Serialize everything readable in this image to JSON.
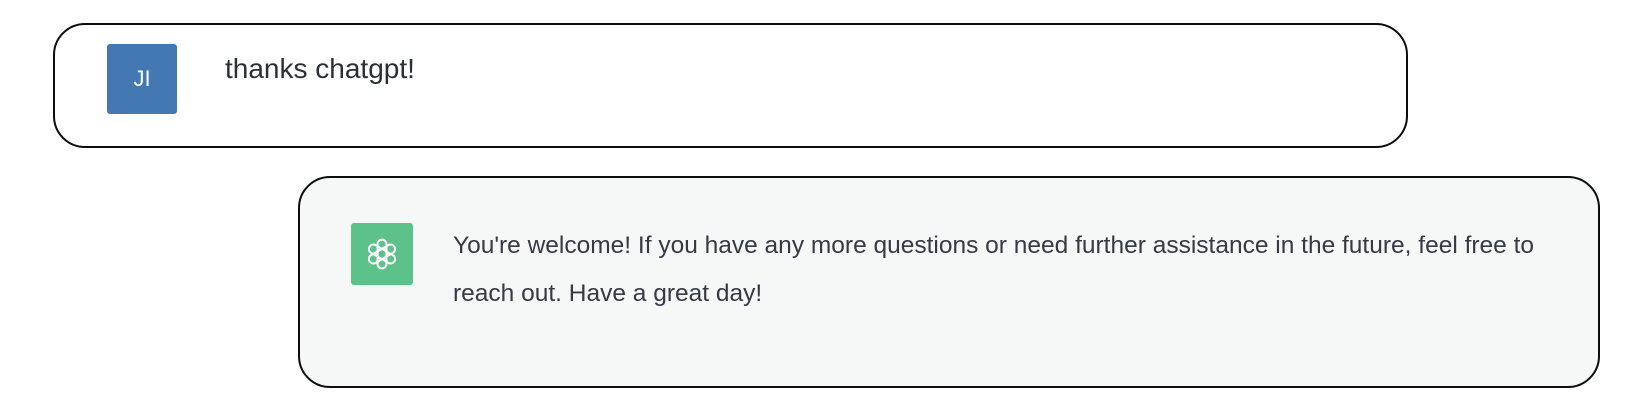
{
  "conversation": {
    "user": {
      "avatar_initials": "JI",
      "avatar_color": "#4478b3",
      "message": "thanks chatgpt!"
    },
    "assistant": {
      "avatar_icon": "openai-logo-icon",
      "avatar_color": "#5cc28a",
      "message": "You're welcome! If you have any more questions or need further assistance in the future, feel free to reach out. Have a great day!"
    }
  }
}
